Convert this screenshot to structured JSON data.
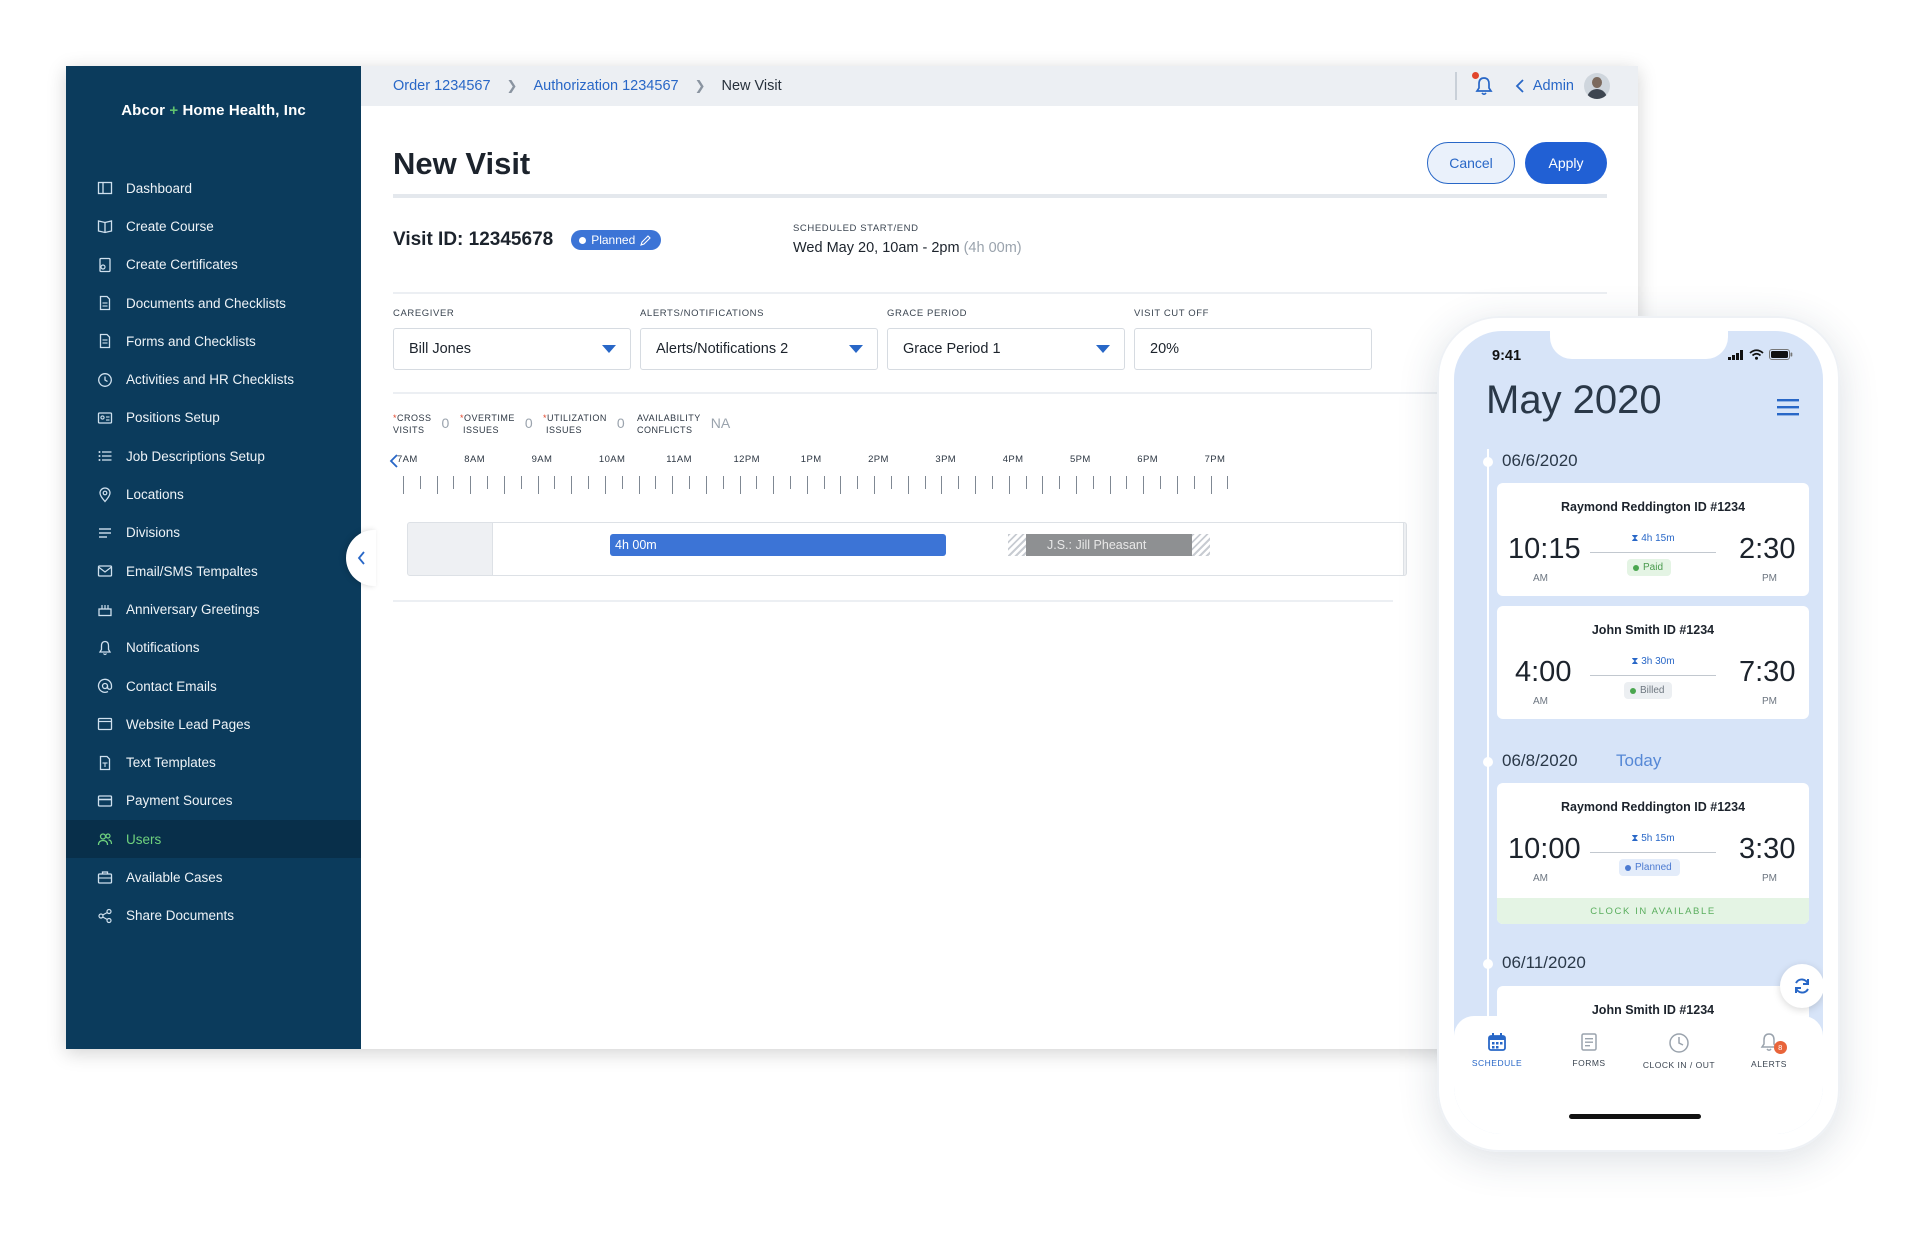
{
  "app": {
    "brand_prefix": "Abcor",
    "brand_plus": "+",
    "brand_suffix": "Home Health, Inc"
  },
  "sidebar": {
    "items": [
      {
        "label": "Dashboard",
        "icon": "dashboard-icon"
      },
      {
        "label": "Create Course",
        "icon": "book-icon"
      },
      {
        "label": "Create Certificates",
        "icon": "certificate-icon"
      },
      {
        "label": "Documents and Checklists",
        "icon": "document-icon"
      },
      {
        "label": "Forms and Checklists",
        "icon": "form-icon"
      },
      {
        "label": "Activities and HR Checklists",
        "icon": "clock-icon"
      },
      {
        "label": "Positions Setup",
        "icon": "id-card-icon"
      },
      {
        "label": "Job Descriptions Setup",
        "icon": "list-icon"
      },
      {
        "label": "Locations",
        "icon": "location-pin-icon"
      },
      {
        "label": "Divisions",
        "icon": "divisions-icon"
      },
      {
        "label": "Email/SMS Tempaltes",
        "icon": "mail-icon"
      },
      {
        "label": "Anniversary Greetings",
        "icon": "cake-icon"
      },
      {
        "label": "Notifications",
        "icon": "bell-icon"
      },
      {
        "label": "Contact Emails",
        "icon": "at-icon"
      },
      {
        "label": "Website Lead Pages",
        "icon": "browser-icon"
      },
      {
        "label": "Text Templates",
        "icon": "text-file-icon"
      },
      {
        "label": "Payment Sources",
        "icon": "credit-card-icon"
      },
      {
        "label": "Users",
        "icon": "users-icon",
        "active": true
      },
      {
        "label": "Available Cases",
        "icon": "briefcase-icon"
      },
      {
        "label": "Share Documents",
        "icon": "share-icon"
      }
    ],
    "active_color": "#6fd27e"
  },
  "breadcrumb": {
    "items": [
      "Order 1234567",
      "Authorization 1234567"
    ],
    "current": "New Visit"
  },
  "header": {
    "admin_label": "Admin"
  },
  "page": {
    "title": "New Visit",
    "cancel_label": "Cancel",
    "apply_label": "Apply",
    "visit_id": "Visit ID: 12345678",
    "status_badge": "Planned",
    "scheduled_label": "SCHEDULED START/END",
    "scheduled_value": "Wed May 20, 10am - 2pm",
    "scheduled_duration": "(4h 00m)"
  },
  "fields": {
    "caregiver": {
      "label": "CAREGIVER",
      "value": "Bill Jones"
    },
    "alerts": {
      "label": "ALERTS/NOTIFICATIONS",
      "value": "Alerts/Notifications 2"
    },
    "grace": {
      "label": "GRACE PERIOD",
      "value": "Grace Period 1"
    },
    "cutoff": {
      "label": "VISIT CUT OFF",
      "value": "20%"
    }
  },
  "stats": {
    "cross_visits": {
      "line1": "CROSS",
      "line2": "VISITS",
      "value": "0"
    },
    "overtime": {
      "line1": "OVERTIME",
      "line2": "ISSUES",
      "value": "0"
    },
    "utilization": {
      "line1": "UTILIZATION",
      "line2": "ISSUES",
      "value": "0"
    },
    "availability": {
      "line1": "AVAILABILITY",
      "line2": "CONFLICTS",
      "value": "NA"
    }
  },
  "timeline": {
    "hours": [
      "7AM",
      "8AM",
      "9AM",
      "10AM",
      "11AM",
      "12PM",
      "1PM",
      "2PM",
      "3PM",
      "4PM",
      "5PM",
      "6PM",
      "7PM"
    ],
    "visit_bar_label": "4h 00m",
    "other_bar_label": "J.S.: Jill Pheasant"
  },
  "phone": {
    "status_time": "9:41",
    "month_title": "May 2020",
    "groups": [
      {
        "date": "06/6/2020",
        "cards": [
          {
            "title": "Raymond Reddington ID #1234",
            "start": "10:15",
            "start_ampm": "AM",
            "end": "2:30",
            "end_ampm": "PM",
            "duration": "4h 15m",
            "status": "Paid"
          },
          {
            "title": "John Smith ID #1234",
            "start": "4:00",
            "start_ampm": "AM",
            "end": "7:30",
            "end_ampm": "PM",
            "duration": "3h 30m",
            "status": "Billed"
          }
        ]
      },
      {
        "date": "06/8/2020",
        "today_label": "Today",
        "cards": [
          {
            "title": "Raymond Reddington ID #1234",
            "start": "10:00",
            "start_ampm": "AM",
            "end": "3:30",
            "end_ampm": "PM",
            "duration": "5h 15m",
            "status": "Planned",
            "footer": "CLOCK IN AVAILABLE"
          }
        ]
      },
      {
        "date": "06/11/2020",
        "cards": [
          {
            "title": "John Smith ID #1234"
          }
        ]
      }
    ],
    "tabs": [
      {
        "label": "SCHEDULE",
        "icon": "calendar-icon",
        "active": true
      },
      {
        "label": "FORMS",
        "icon": "forms-icon"
      },
      {
        "label": "CLOCK IN / OUT",
        "icon": "clock-icon"
      },
      {
        "label": "ALERTS",
        "icon": "bell-icon",
        "badge": "8"
      }
    ]
  },
  "colors": {
    "sidebar_bg": "#0b3b5c",
    "accent_blue": "#2867c7",
    "apply_blue": "#2160d4",
    "bar_blue": "#3c74d6",
    "phone_screen_bg": "#d7e4f8"
  }
}
